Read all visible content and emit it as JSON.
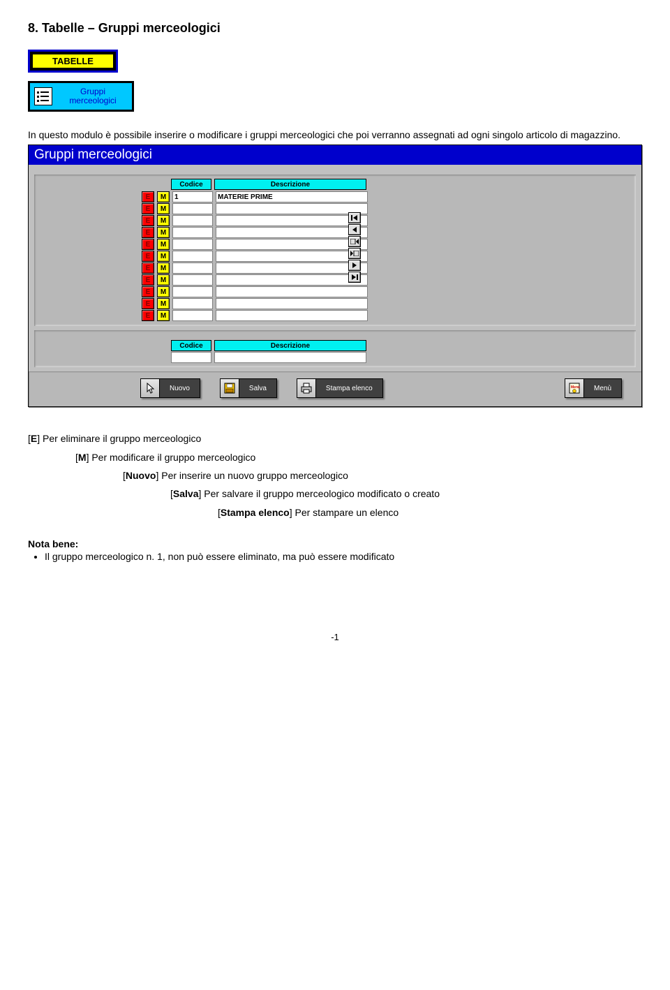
{
  "heading": "8. Tabelle – Gruppi merceologici",
  "badge_tabelle": "TABELLE",
  "badge_gruppi": "Gruppi merceologici",
  "intro": "In questo modulo è possibile inserire o modificare i gruppi merceologici che poi verranno assegnati ad ogni singolo articolo di magazzino.",
  "window": {
    "title": "Gruppi merceologici",
    "col_codice": "Codice",
    "col_descrizione": "Descrizione",
    "btn_e": "E",
    "btn_m": "M",
    "rows": [
      {
        "codice": "1",
        "descrizione": "MATERIE PRIME"
      },
      {
        "codice": "",
        "descrizione": ""
      },
      {
        "codice": "",
        "descrizione": ""
      },
      {
        "codice": "",
        "descrizione": ""
      },
      {
        "codice": "",
        "descrizione": ""
      },
      {
        "codice": "",
        "descrizione": ""
      },
      {
        "codice": "",
        "descrizione": ""
      },
      {
        "codice": "",
        "descrizione": ""
      },
      {
        "codice": "",
        "descrizione": ""
      },
      {
        "codice": "",
        "descrizione": ""
      },
      {
        "codice": "",
        "descrizione": ""
      }
    ],
    "footer_codice": "Codice",
    "footer_descrizione": "Descrizione",
    "buttons": {
      "nuovo": "Nuovo",
      "salva": "Salva",
      "stampa": "Stampa elenco",
      "menu": "Menù"
    }
  },
  "legend": {
    "e": "[E] Per eliminare il gruppo merceologico",
    "m": "[M] Per modificare il gruppo merceologico",
    "nuovo": "[Nuovo] Per inserire un nuovo gruppo merceologico",
    "salva": "[Salva] Per salvare il gruppo merceologico modificato o creato",
    "stampa": "[Stampa elenco] Per stampare un elenco"
  },
  "nota": {
    "title": "Nota bene:",
    "item": "Il gruppo merceologico n. 1, non può essere eliminato, ma può essere modificato"
  },
  "page_num": "-1"
}
